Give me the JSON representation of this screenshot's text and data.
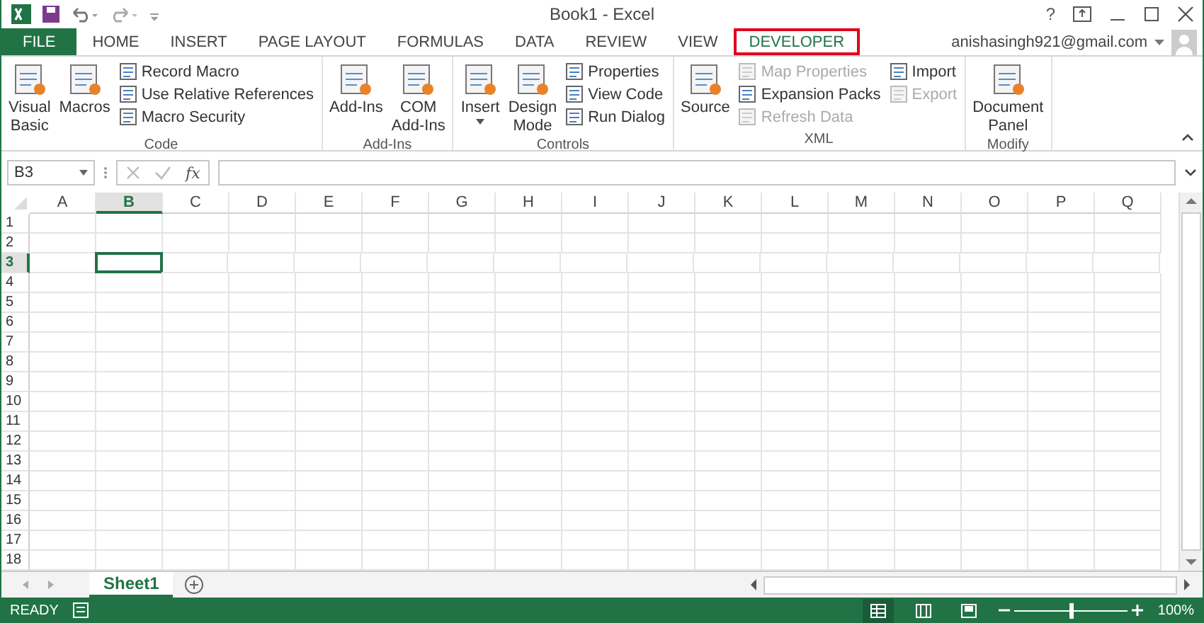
{
  "window": {
    "title": "Book1 - Excel",
    "controls": [
      "?"
    ]
  },
  "tabs": [
    {
      "label": "FILE",
      "kind": "file",
      "selected": false
    },
    {
      "label": "HOME",
      "kind": "tab",
      "selected": false
    },
    {
      "label": "INSERT",
      "kind": "tab",
      "selected": false
    },
    {
      "label": "PAGE LAYOUT",
      "kind": "tab",
      "selected": false
    },
    {
      "label": "FORMULAS",
      "kind": "tab",
      "selected": false
    },
    {
      "label": "DATA",
      "kind": "tab",
      "selected": false
    },
    {
      "label": "REVIEW",
      "kind": "tab",
      "selected": false
    },
    {
      "label": "VIEW",
      "kind": "tab",
      "selected": false
    },
    {
      "label": "DEVELOPER",
      "kind": "tab",
      "selected": true,
      "highlighted": true
    }
  ],
  "account": {
    "email": "anishasingh921@gmail.com"
  },
  "ribbon": [
    {
      "label": "Code",
      "columns": [
        {
          "kind": "large",
          "lines": [
            "Visual",
            "Basic"
          ],
          "dropdown": false
        },
        {
          "kind": "large",
          "lines": [
            "Macros"
          ],
          "dropdown": false
        },
        {
          "kind": "stack",
          "items": [
            {
              "label": "Record Macro",
              "disabled": false
            },
            {
              "label": "Use Relative References",
              "disabled": false
            },
            {
              "label": "Macro Security",
              "disabled": false
            }
          ]
        }
      ]
    },
    {
      "label": "Add-Ins",
      "columns": [
        {
          "kind": "large",
          "lines": [
            "Add-Ins"
          ],
          "dropdown": false
        },
        {
          "kind": "large",
          "lines": [
            "COM",
            "Add-Ins"
          ],
          "dropdown": false
        }
      ]
    },
    {
      "label": "Controls",
      "columns": [
        {
          "kind": "large",
          "lines": [
            "Insert"
          ],
          "dropdown": true
        },
        {
          "kind": "large",
          "lines": [
            "Design",
            "Mode"
          ],
          "dropdown": false
        },
        {
          "kind": "stack",
          "items": [
            {
              "label": "Properties",
              "disabled": false
            },
            {
              "label": "View Code",
              "disabled": false
            },
            {
              "label": "Run Dialog",
              "disabled": false
            }
          ]
        }
      ]
    },
    {
      "label": "XML",
      "columns": [
        {
          "kind": "large",
          "lines": [
            "Source"
          ],
          "dropdown": false
        },
        {
          "kind": "stack",
          "items": [
            {
              "label": "Map Properties",
              "disabled": true
            },
            {
              "label": "Expansion Packs",
              "disabled": false
            },
            {
              "label": "Refresh Data",
              "disabled": true
            }
          ]
        },
        {
          "kind": "stack",
          "items": [
            {
              "label": "Import",
              "disabled": false
            },
            {
              "label": "Export",
              "disabled": true
            }
          ]
        }
      ]
    },
    {
      "label": "Modify",
      "columns": [
        {
          "kind": "large",
          "lines": [
            "Document",
            "Panel"
          ],
          "dropdown": false
        }
      ]
    }
  ],
  "formula_bar": {
    "name_box": "B3",
    "fx": "fx"
  },
  "sheet": {
    "columns": [
      {
        "label": "A",
        "selected": false
      },
      {
        "label": "B",
        "selected": true
      },
      {
        "label": "C",
        "selected": false
      },
      {
        "label": "D",
        "selected": false
      },
      {
        "label": "E",
        "selected": false
      },
      {
        "label": "F",
        "selected": false
      },
      {
        "label": "G",
        "selected": false
      },
      {
        "label": "H",
        "selected": false
      },
      {
        "label": "I",
        "selected": false
      },
      {
        "label": "J",
        "selected": false
      },
      {
        "label": "K",
        "selected": false
      },
      {
        "label": "L",
        "selected": false
      },
      {
        "label": "M",
        "selected": false
      },
      {
        "label": "N",
        "selected": false
      },
      {
        "label": "O",
        "selected": false
      },
      {
        "label": "P",
        "selected": false
      },
      {
        "label": "Q",
        "selected": false
      }
    ],
    "rows": [
      {
        "label": "1",
        "selected": false
      },
      {
        "label": "2",
        "selected": false
      },
      {
        "label": "3",
        "selected": true
      },
      {
        "label": "4",
        "selected": false
      },
      {
        "label": "5",
        "selected": false
      },
      {
        "label": "6",
        "selected": false
      },
      {
        "label": "7",
        "selected": false
      },
      {
        "label": "8",
        "selected": false
      },
      {
        "label": "9",
        "selected": false
      },
      {
        "label": "10",
        "selected": false
      },
      {
        "label": "11",
        "selected": false
      },
      {
        "label": "12",
        "selected": false
      },
      {
        "label": "13",
        "selected": false
      },
      {
        "label": "14",
        "selected": false
      },
      {
        "label": "15",
        "selected": false
      },
      {
        "label": "16",
        "selected": false
      },
      {
        "label": "17",
        "selected": false
      },
      {
        "label": "18",
        "selected": false
      }
    ]
  },
  "sheet_tabs": [
    {
      "label": "Sheet1",
      "selected": true
    }
  ],
  "status_bar": {
    "status": "READY",
    "zoom": "100%",
    "zoom_slider": {
      "level": 0.5
    }
  }
}
